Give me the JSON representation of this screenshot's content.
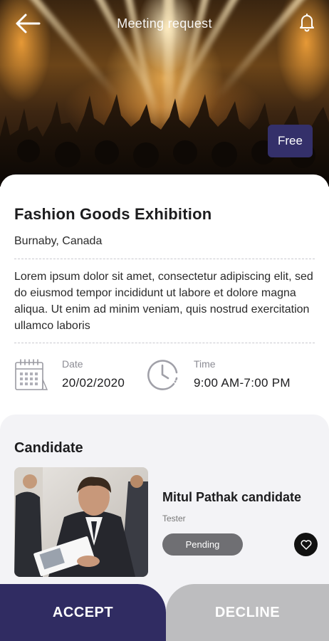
{
  "header": {
    "title": "Meeting request",
    "back_icon": "arrow-left-icon",
    "notification_icon": "bell-icon"
  },
  "hero": {
    "badge": "Free"
  },
  "event": {
    "title": "Fashion Goods Exhibition",
    "location": "Burnaby, Canada",
    "description": "Lorem ipsum dolor sit amet, consectetur adipiscing elit, sed do eiusmod tempor incididunt ut labore et dolore magna aliqua. Ut enim ad minim veniam, quis nostrud exercitation ullamco laboris",
    "date_label": "Date",
    "date_value": "20/02/2020",
    "time_label": "Time",
    "time_value": "9:00 AM-7:00 PM"
  },
  "candidate": {
    "heading": "Candidate",
    "name": "Mitul Pathak candidate",
    "role": "Tester",
    "status": "Pending",
    "favorite_icon": "heart-icon"
  },
  "actions": {
    "accept": "ACCEPT",
    "decline": "DECLINE"
  },
  "colors": {
    "primary": "#302c62",
    "badge": "#34306a",
    "decline": "#bdbdbf",
    "pending": "#6f6f73",
    "section_bg": "#f3f3f6"
  }
}
